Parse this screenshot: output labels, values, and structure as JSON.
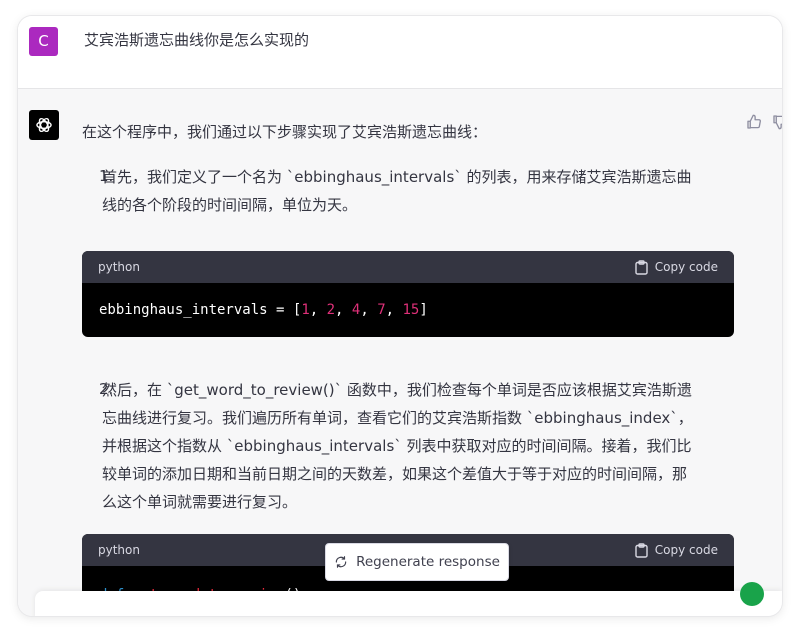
{
  "user": {
    "avatar_letter": "C",
    "message": "艾宾浩斯遗忘曲线你是怎么实现的"
  },
  "assistant": {
    "intro": "在这个程序中，我们通过以下步骤实现了艾宾浩斯遗忘曲线：",
    "steps": [
      {
        "number": "1.",
        "lines": [
          "首先，我们定义了一个名为 `ebbinghaus_intervals` 的列表，用来存储艾宾浩斯遗忘曲",
          "线的各个阶段的时间间隔，单位为天。"
        ]
      },
      {
        "number": "2.",
        "lines": [
          "然后，在 `get_word_to_review()` 函数中，我们检查每个单词是否应该根据艾宾浩斯遗",
          "忘曲线进行复习。我们遍历所有单词，查看它们的艾宾浩斯指数 `ebbinghaus_index`，",
          "并根据这个指数从 `ebbinghaus_intervals` 列表中获取对应的时间间隔。接着，我们比",
          "较单词的添加日期和当前日期之间的天数差，如果这个差值大于等于对应的时间间隔，那",
          "么这个单词就需要进行复习。"
        ]
      }
    ],
    "code_blocks": [
      {
        "language": "python",
        "copy_label": "Copy code",
        "code": {
          "var": "ebbinghaus_intervals",
          "eq": " = ",
          "open": "[",
          "n1": "1",
          "n2": "2",
          "n3": "4",
          "n4": "7",
          "n5": "15",
          "sep": ", ",
          "close": "]"
        }
      },
      {
        "language": "python",
        "copy_label": "Copy code",
        "code": {
          "kw": "def",
          "fn": "get_word_to_review",
          "rest": "():"
        }
      }
    ]
  },
  "regenerate_label": "Regenerate response",
  "colors": {
    "user_avatar": "#ab29bf",
    "number": "#df3079",
    "keyword": "#2e95d3",
    "function": "#f22c3d"
  }
}
